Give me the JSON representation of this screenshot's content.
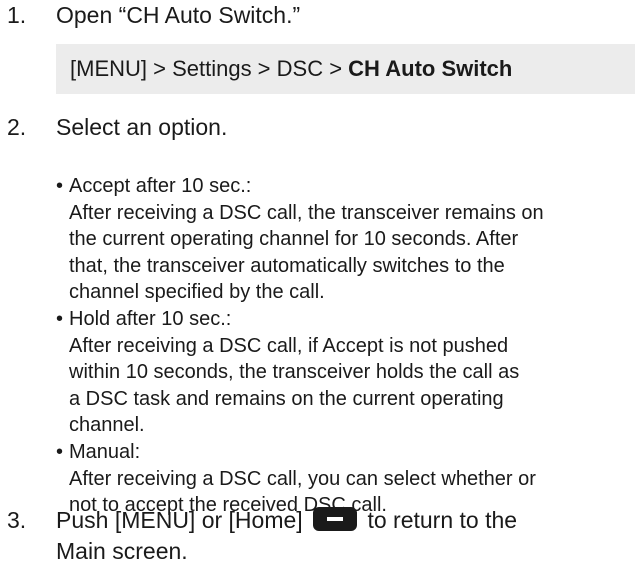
{
  "step1": {
    "number": "1.",
    "text": "Open “CH Auto Switch.”",
    "path_prefix": "[MENU] > Settings > DSC > ",
    "path_target": "CH Auto Switch"
  },
  "step2": {
    "number": "2.",
    "text": "Select an option.",
    "options": [
      {
        "title": "Accept after 10 sec.:",
        "lines": [
          "After receiving a DSC call, the transceiver remains on",
          "the current operating channel for 10 seconds. After",
          "that, the transceiver automatically switches to the",
          "channel specified by the call."
        ]
      },
      {
        "title": "Hold after 10 sec.:",
        "lines": [
          "After receiving a DSC call, if Accept is not pushed",
          "within 10 seconds, the transceiver holds the call as",
          "a DSC task and remains on the current operating",
          "channel."
        ]
      },
      {
        "title": "Manual:",
        "lines": [
          "After receiving a DSC call, you can select whether or",
          "not to accept the received DSC call."
        ]
      }
    ]
  },
  "step3": {
    "number": "3.",
    "text_before_key": "Push [MENU] or [Home]",
    "text_after_key": "to return to the",
    "text_line2": "Main screen.",
    "key_icon": "minus-key-icon"
  }
}
